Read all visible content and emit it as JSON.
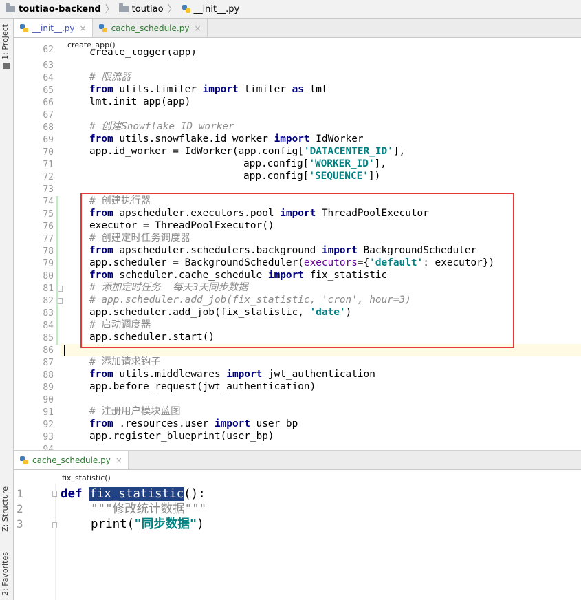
{
  "breadcrumb": {
    "project": "toutiao-backend",
    "folder": "toutiao",
    "file": "__init__.py"
  },
  "tool_windows": {
    "project": "1: Project",
    "structure": "Z: Structure",
    "favorites": "2: Favorites"
  },
  "tabs": [
    {
      "label": "__init__.py",
      "close": "×"
    },
    {
      "label": "cache_schedule.py",
      "close": "×"
    }
  ],
  "editor1": {
    "breadcrumb": "create_app()",
    "line_numbers": [
      "62",
      "63",
      "64",
      "65",
      "66",
      "67",
      "68",
      "69",
      "70",
      "71",
      "72",
      "73",
      "74",
      "75",
      "76",
      "77",
      "78",
      "79",
      "80",
      "81",
      "82",
      "83",
      "84",
      "85",
      "86",
      "87",
      "88",
      "89",
      "90",
      "91",
      "92",
      "93",
      "94"
    ],
    "lines": {
      "l62": "create_logger(app)",
      "l64c": "# 限流器",
      "l65a": "from",
      "l65b": " utils.limiter ",
      "l65c": "import",
      "l65d": " limiter ",
      "l65e": "as",
      "l65f": " lmt",
      "l66": "lmt.init_app(app)",
      "l68c": "# 创建Snowflake ID worker",
      "l69a": "from",
      "l69b": " utils.snowflake.id_worker ",
      "l69c": "import",
      "l69d": " IdWorker",
      "l70a": "app.id_worker = IdWorker(app.config[",
      "l70b": "'DATACENTER_ID'",
      "l70c": "],",
      "l71a": "app.config[",
      "l71b": "'WORKER_ID'",
      "l71c": "],",
      "l72a": "app.config[",
      "l72b": "'SEQUENCE'",
      "l72c": "])",
      "l74c": "# 创建执行器",
      "l75a": "from",
      "l75b": " apscheduler.executors.pool ",
      "l75c": "import",
      "l75d": " ThreadPoolExecutor",
      "l76": "executor = ThreadPoolExecutor()",
      "l77c": "# 创建定时任务调度器",
      "l78a": "from",
      "l78b": " apscheduler.schedulers.background ",
      "l78c": "import",
      "l78d": " BackgroundScheduler",
      "l79a": "app.scheduler = BackgroundScheduler(",
      "l79b": "executors",
      "l79c": "={",
      "l79d": "'default'",
      "l79e": ": executor})",
      "l80a": "from",
      "l80b": " scheduler.cache_schedule ",
      "l80c": "import",
      "l80d": " fix_statistic",
      "l81c": "# 添加定时任务  每天3天同步数据",
      "l82c": "# app.scheduler.add_job(fix_statistic, 'cron', hour=3)",
      "l83a": "app.scheduler.add_job(fix_statistic, ",
      "l83b": "'date'",
      "l83c": ")",
      "l84c": "# 启动调度器",
      "l85": "app.scheduler.start()",
      "l87c": "# 添加请求钩子",
      "l88a": "from",
      "l88b": " utils.middlewares ",
      "l88c": "import",
      "l88d": " jwt_authentication",
      "l89": "app.before_request(jwt_authentication)",
      "l91c": "# 注册用户模块蓝图",
      "l92a": "from",
      "l92b": " .resources.user ",
      "l92c": "import",
      "l92d": " user_bp",
      "l93": "app.register_blueprint(user_bp)"
    }
  },
  "editor2": {
    "tab": {
      "label": "cache_schedule.py",
      "close": "×"
    },
    "breadcrumb": "fix_statistic()",
    "line_numbers": [
      "1",
      "2",
      "3"
    ],
    "l1a": "def",
    "l1b": "fix_statistic",
    "l1c": "():",
    "l2": "\"\"\"修改统计数据\"\"\"",
    "l3a": "print(",
    "l3b": "\"同步数据\"",
    "l3c": ")"
  },
  "colors": {
    "keyword": "#000080",
    "comment": "#8c8c8c",
    "string": "#008080",
    "highlight_box": "#e53935",
    "caret_line": "#fffae3"
  }
}
